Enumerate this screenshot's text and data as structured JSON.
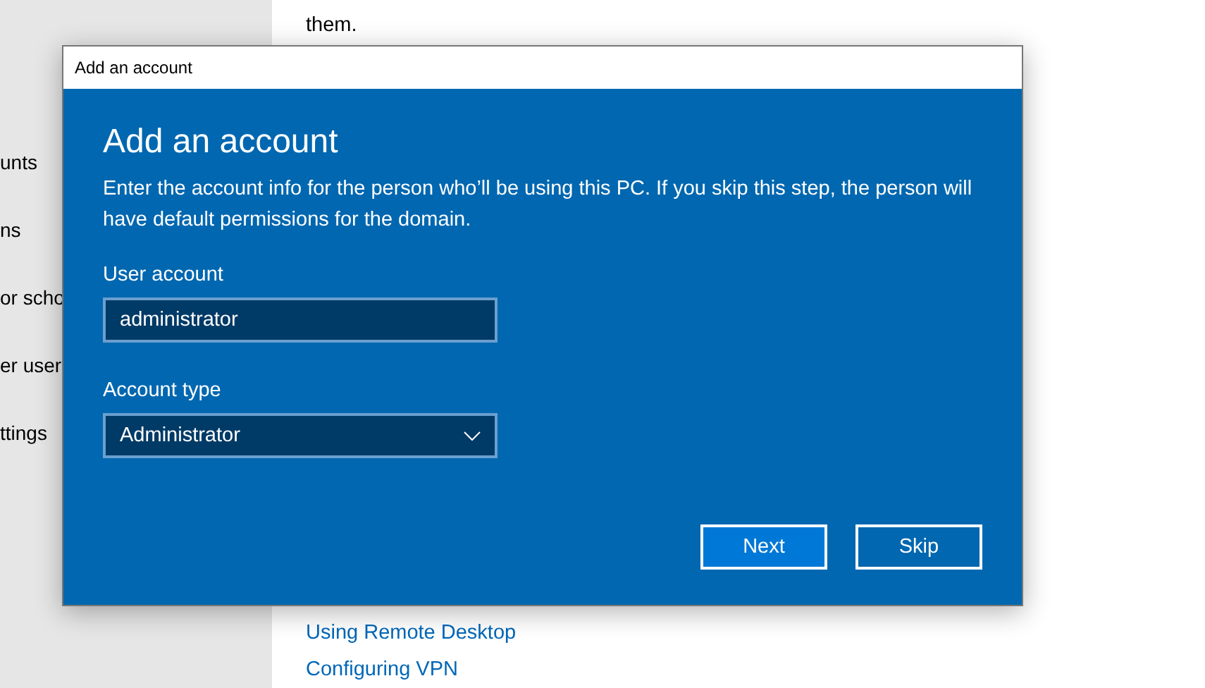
{
  "background": {
    "sidebar_items": [
      "unts",
      "ns",
      "or scho",
      "er user",
      "ttings"
    ],
    "intro_text": "them.",
    "links": [
      "Using Remote Desktop",
      "Configuring VPN"
    ]
  },
  "dialog": {
    "title": "Add an account",
    "heading": "Add an account",
    "description": "Enter the account info for the person who’ll be using this PC. If you skip this step, the person will have default permissions for the domain.",
    "fields": [
      {
        "kind": "text",
        "label": "User account",
        "value": "administrator"
      },
      {
        "kind": "dropdown",
        "label": "Account type",
        "value": "Administrator"
      }
    ],
    "buttons": [
      {
        "label": "Next",
        "primary": true
      },
      {
        "label": "Skip",
        "primary": false
      }
    ]
  }
}
